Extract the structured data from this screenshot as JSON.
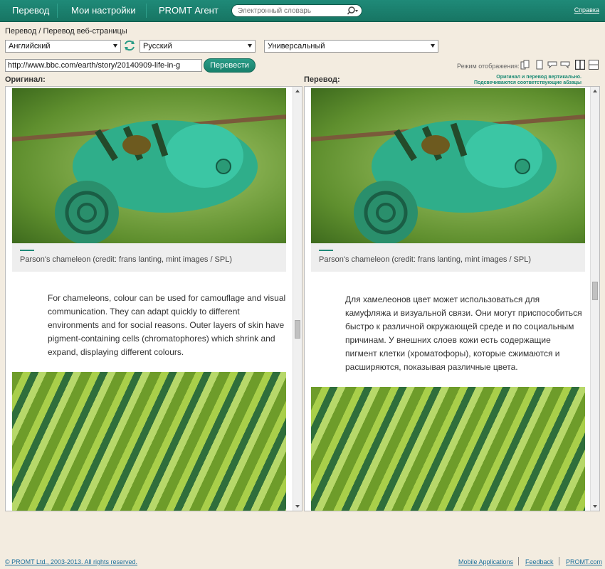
{
  "nav": {
    "translate": "Перевод",
    "settings": "Мои настройки",
    "agent": "PROMT Агент",
    "dictionary_placeholder": "Электронный словарь",
    "help": "Справка"
  },
  "breadcrumb": "Перевод / Перевод веб-страницы",
  "languages": {
    "source": "Английский",
    "target": "Русский",
    "topic": "Универсальный"
  },
  "url_value": "http://www.bbc.com/earth/story/20140909-life-in-g",
  "translate_button": "Перевести",
  "display_mode": {
    "label": "Режим отображения:",
    "hint_line1": "Оригинал и перевод вертикально.",
    "hint_line2": "Подсвечиваются соответствующие абзацы"
  },
  "panels": {
    "original_label": "Оригинал:",
    "translation_label": "Перевод:",
    "original": {
      "caption": "Parson's chameleon (credit: frans lanting, mint images / SPL)",
      "paragraph": [
        "For chameleons, colour can be used for camouflage and visual",
        "communication. They can adapt quickly to different",
        "environments and for social reasons. Outer layers of skin have",
        "pigment-containing cells (chromatophores) which shrink and",
        "expand, displaying different colours."
      ]
    },
    "translation": {
      "caption": "Parson's chameleon (credit: frans lanting, mint images / SPL)",
      "paragraph": [
        "Для хамелеонов цвет может использоваться для",
        "камуфляжа и визуальной связи. Они могут приспособиться",
        "быстро к различной окружающей среде и по социальным",
        "причинам. У внешних слоев кожи есть содержащие",
        "пигмент клетки (хроматофоры), которые сжимаются и",
        "расширяются, показывая различные цвета."
      ]
    }
  },
  "footer": {
    "copyright": "© PROMT Ltd., 2003-2013. All rights reserved.",
    "mobile": "Mobile Applications",
    "feedback": "Feedback",
    "site": "PROMT.com"
  },
  "colors": {
    "accent": "#1f8a78",
    "background": "#f3ece0"
  }
}
